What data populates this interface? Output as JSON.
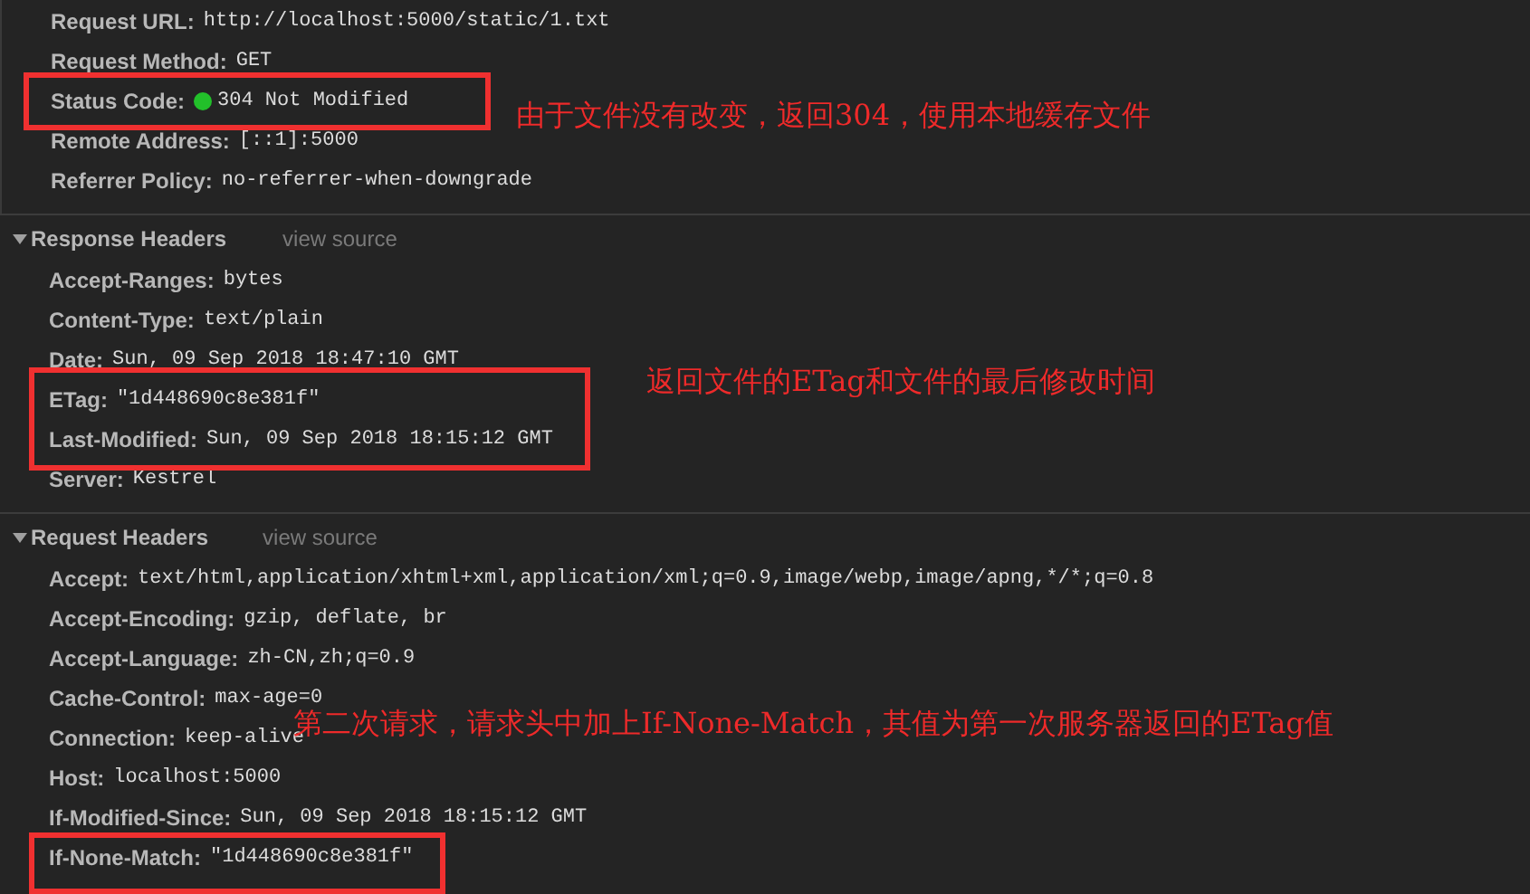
{
  "general": [
    {
      "key": "Request URL:",
      "value": "http://localhost:5000/static/1.txt"
    },
    {
      "key": "Request Method:",
      "value": "GET"
    },
    {
      "key": "Status Code:",
      "value": "304 Not Modified",
      "color": "#22c02a"
    },
    {
      "key": "Remote Address:",
      "value": "[::1]:5000"
    },
    {
      "key": "Referrer Policy:",
      "value": "no-referrer-when-downgrade"
    }
  ],
  "sections": [
    {
      "title": "Response Headers",
      "expanded": true,
      "link": "view source",
      "rows": [
        {
          "key": "Accept-Ranges:",
          "value": "bytes"
        },
        {
          "key": "Content-Type:",
          "value": "text/plain"
        },
        {
          "key": "Date:",
          "value": "Sun, 09 Sep 2018 18:47:10 GMT"
        },
        {
          "key": "ETag:",
          "value": "\"1d448690c8e381f\""
        },
        {
          "key": "Last-Modified:",
          "value": "Sun, 09 Sep 2018 18:15:12 GMT"
        },
        {
          "key": "Server:",
          "value": "Kestrel"
        }
      ]
    },
    {
      "title": "Request Headers",
      "expanded": true,
      "link": "view source",
      "rows": [
        {
          "key": "Accept:",
          "value": "text/html,application/xhtml+xml,application/xml;q=0.9,image/webp,image/apng,*/*;q=0.8"
        },
        {
          "key": "Accept-Encoding:",
          "value": "gzip, deflate, br"
        },
        {
          "key": "Accept-Language:",
          "value": "zh-CN,zh;q=0.9"
        },
        {
          "key": "Cache-Control:",
          "value": "max-age=0"
        },
        {
          "key": "Connection:",
          "value": "keep-alive"
        },
        {
          "key": "Host:",
          "value": "localhost:5000"
        },
        {
          "key": "If-Modified-Since:",
          "value": "Sun, 09 Sep 2018 18:15:12 GMT"
        },
        {
          "key": "If-None-Match:",
          "value": "\"1d448690c8e381f\""
        }
      ]
    }
  ],
  "annotations": [
    {
      "text": "由于文件没有改变，返回304，使用本地缓存文件"
    },
    {
      "text": "返回文件的ETag和文件的最后修改时间"
    },
    {
      "text": "第二次请求，请求头中加上If-None-Match，其值为第一次服务器返回的ETag值"
    }
  ]
}
